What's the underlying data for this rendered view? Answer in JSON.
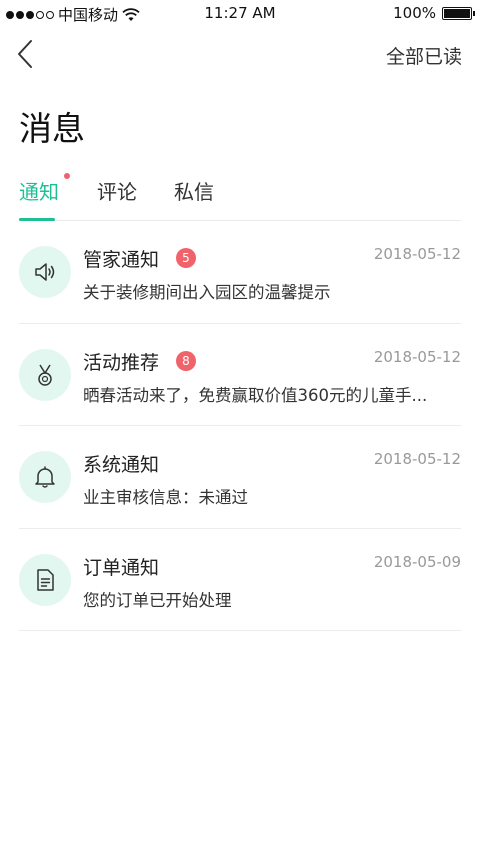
{
  "status_bar": {
    "carrier": "中国移动",
    "time": "11:27 AM",
    "battery": "100%"
  },
  "nav": {
    "mark_all_read": "全部已读"
  },
  "page_title": "消息",
  "tabs": [
    {
      "label": "通知",
      "active": true,
      "has_dot": true
    },
    {
      "label": "评论",
      "active": false
    },
    {
      "label": "私信",
      "active": false
    }
  ],
  "colors": {
    "accent": "#1fbf96",
    "badge": "#f0636b",
    "icon_bg": "#e3f7f1"
  },
  "messages": [
    {
      "icon": "speaker-icon",
      "title": "管家通知",
      "badge": "5",
      "date": "2018-05-12",
      "preview": "关于装修期间出入园区的温馨提示"
    },
    {
      "icon": "medal-icon",
      "title": "活动推荐",
      "badge": "8",
      "date": "2018-05-12",
      "preview": "晒春活动来了，免费赢取价值360元的儿童手..."
    },
    {
      "icon": "bell-icon",
      "title": "系统通知",
      "badge": "",
      "date": "2018-05-12",
      "preview": "业主审核信息：未通过"
    },
    {
      "icon": "document-icon",
      "title": "订单通知",
      "badge": "",
      "date": "2018-05-09",
      "preview": "您的订单已开始处理"
    }
  ]
}
